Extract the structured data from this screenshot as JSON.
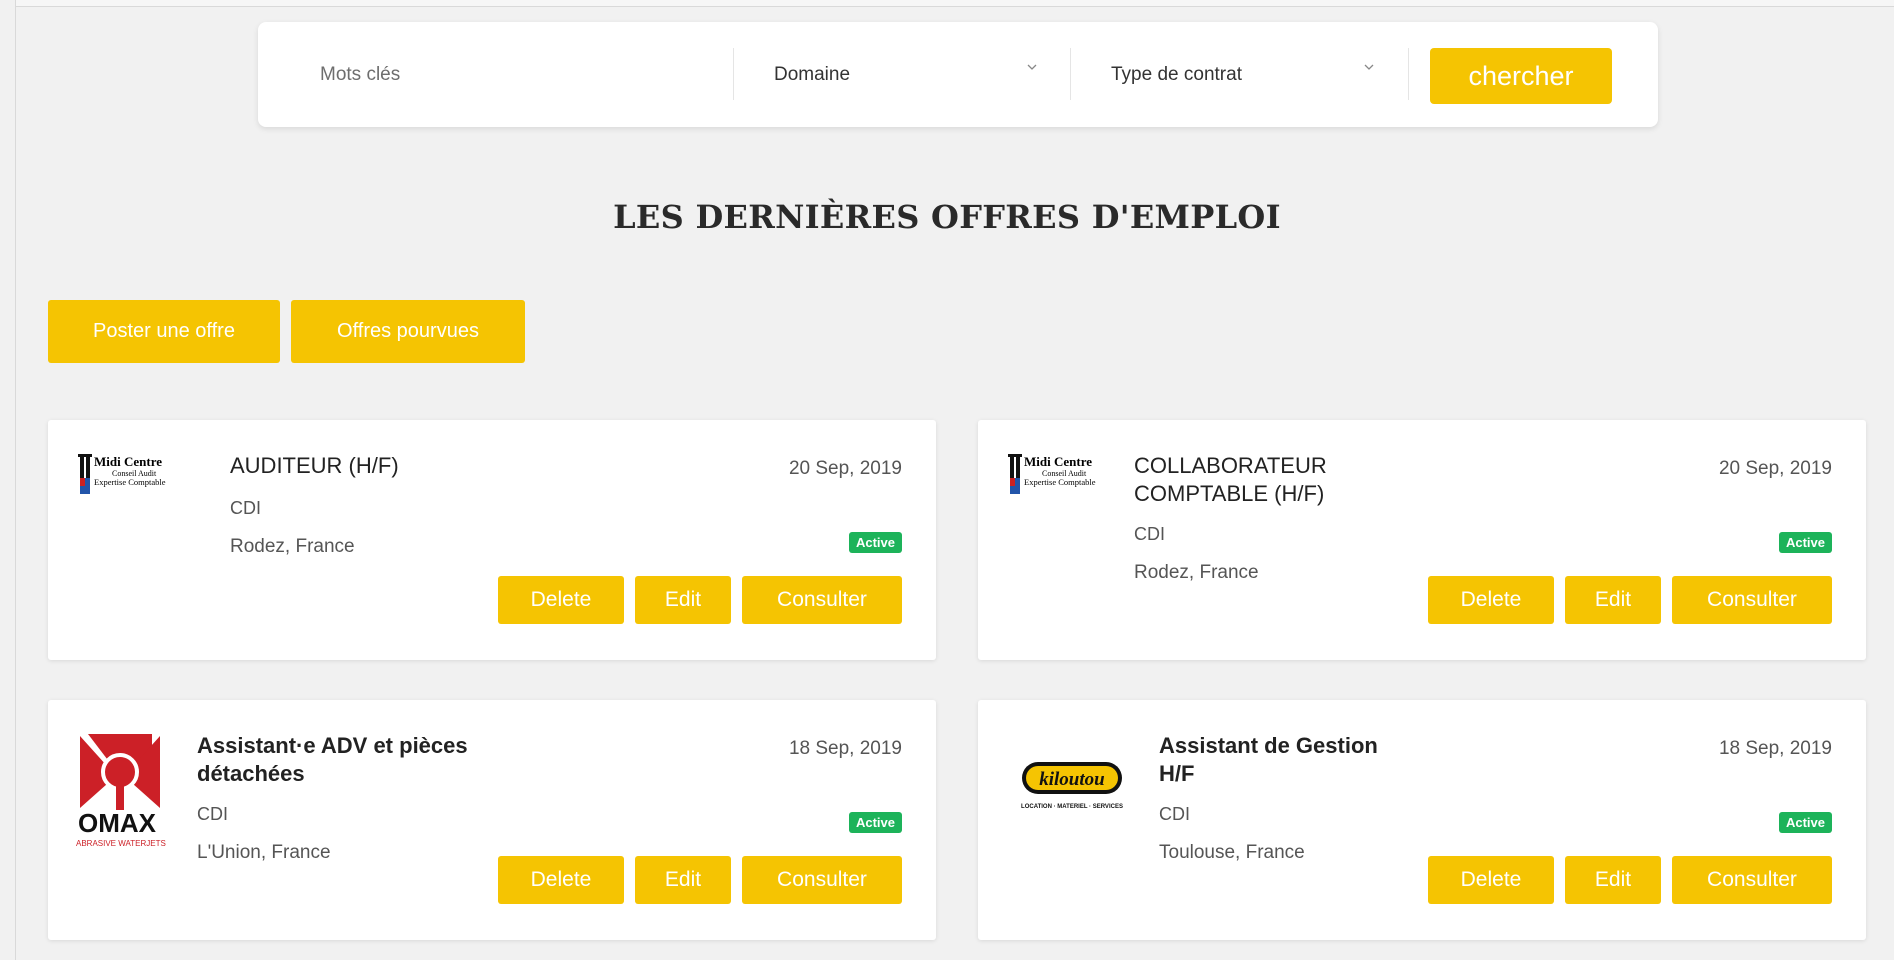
{
  "search": {
    "keywords_placeholder": "Mots clés",
    "domain_label": "Domaine",
    "contract_label": "Type de contrat",
    "search_button": "chercher"
  },
  "page": {
    "title": "LES DERNIÈRES OFFRES D'EMPLOI",
    "post_offer_button": "Poster une offre",
    "filled_offers_button": "Offres pourvues"
  },
  "jobs": [
    {
      "title": "AUDITEUR (H/F)",
      "contract": "CDI",
      "location": "Rodez, France",
      "date": "20 Sep, 2019",
      "status": "Active",
      "company_logo": "midi-centre",
      "logo_text": [
        "Midi Centre",
        "Conseil Audit",
        "Expertise Comptable"
      ]
    },
    {
      "title": "COLLABORATEUR COMPTABLE (H/F)",
      "contract": "CDI",
      "location": "Rodez, France",
      "date": "20 Sep, 2019",
      "status": "Active",
      "company_logo": "midi-centre",
      "logo_text": [
        "Midi Centre",
        "Conseil Audit",
        "Expertise Comptable"
      ]
    },
    {
      "title": "Assistant·e ADV et pièces détachées",
      "contract": "CDI",
      "location": "L'Union, France",
      "date": "18 Sep, 2019",
      "status": "Active",
      "company_logo": "omax",
      "logo_text": [
        "OMAX",
        "ABRASIVE WATERJETS"
      ]
    },
    {
      "title": "Assistant de Gestion H/F",
      "contract": "CDI",
      "location": "Toulouse, France",
      "date": "18 Sep, 2019",
      "status": "Active",
      "company_logo": "kiloutou",
      "logo_text": [
        "kiloutou",
        "LOCATION · MATERIEL · SERVICES"
      ]
    }
  ],
  "card_actions": {
    "delete": "Delete",
    "edit": "Edit",
    "consult": "Consulter"
  },
  "colors": {
    "accent": "#f5c402",
    "active_badge": "#1db35a",
    "background": "#f1f1f1"
  }
}
